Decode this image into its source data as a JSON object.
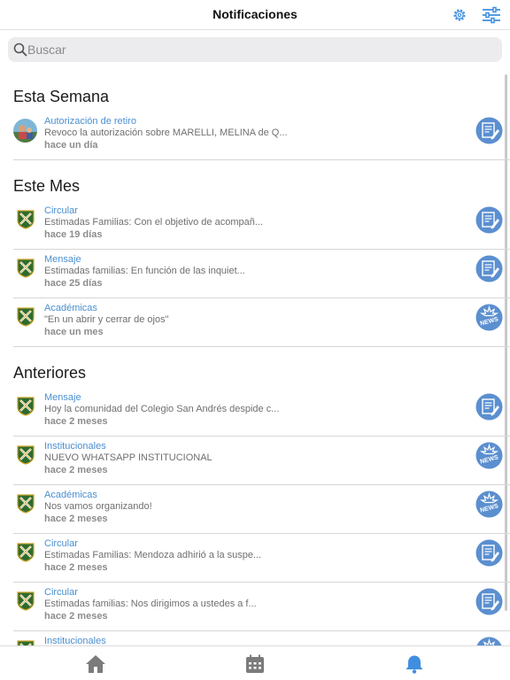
{
  "header": {
    "title": "Notificaciones",
    "settings_icon": "gear-icon",
    "filter_icon": "sliders-icon"
  },
  "search": {
    "placeholder": "Buscar",
    "icon": "search-icon"
  },
  "colors": {
    "accent": "#4a8fd0",
    "badge": "#5b8fd0",
    "active_tab": "#3f8ee0",
    "inactive_tab": "#7b7b7b"
  },
  "sections": [
    {
      "title": "Esta Semana",
      "items": [
        {
          "type": "Autorización de retiro",
          "preview": "Revoco la autorización sobre MARELLI, MELINA de Q...",
          "time": "hace un día",
          "avatar": "photo",
          "badge": "document"
        }
      ]
    },
    {
      "title": "Este Mes",
      "items": [
        {
          "type": "Circular",
          "preview": "Estimadas Familias: Con el objetivo de acompañ...",
          "time": "hace 19 días",
          "avatar": "crest",
          "badge": "document"
        },
        {
          "type": "Mensaje",
          "preview": "Estimadas familias: En función de las inquiet...",
          "time": "hace 25 días",
          "avatar": "crest",
          "badge": "document"
        },
        {
          "type": "Académicas",
          "preview": "\"En un abrir y cerrar de ojos\"",
          "time": "hace un mes",
          "avatar": "crest",
          "badge": "news"
        }
      ]
    },
    {
      "title": "Anteriores",
      "items": [
        {
          "type": "Mensaje",
          "preview": "Hoy la comunidad del Colegio San Andrés despide c...",
          "time": "hace 2 meses",
          "avatar": "crest",
          "badge": "document"
        },
        {
          "type": "Institucionales",
          "preview": "NUEVO WHATSAPP INSTITUCIONAL",
          "time": "hace 2 meses",
          "avatar": "crest",
          "badge": "news"
        },
        {
          "type": "Académicas",
          "preview": "Nos vamos organizando!",
          "time": "hace 2 meses",
          "avatar": "crest",
          "badge": "news"
        },
        {
          "type": "Circular",
          "preview": "Estimadas Familias: Mendoza adhirió a la suspe...",
          "time": "hace 2 meses",
          "avatar": "crest",
          "badge": "document"
        },
        {
          "type": "Circular",
          "preview": "Estimadas familias: Nos dirigimos a ustedes a f...",
          "time": "hace 2 meses",
          "avatar": "crest",
          "badge": "document"
        },
        {
          "type": "Institucionales",
          "preview": "",
          "time": "",
          "avatar": "crest",
          "badge": "news"
        }
      ]
    }
  ],
  "badge_text": {
    "news": "NEWS"
  },
  "tabbar": [
    {
      "name": "home-icon",
      "active": false
    },
    {
      "name": "calendar-icon",
      "active": false
    },
    {
      "name": "bell-icon",
      "active": true
    }
  ]
}
